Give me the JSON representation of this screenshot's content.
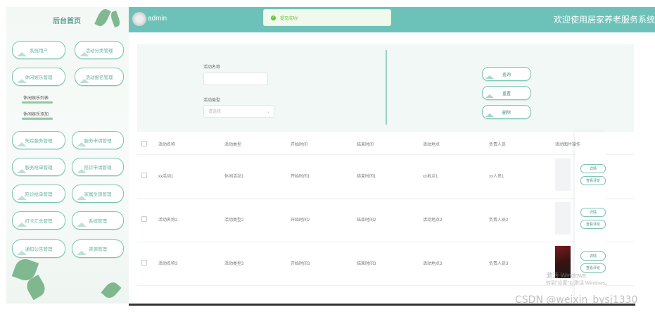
{
  "sidebar": {
    "title": "后台首页",
    "buttons": [
      {
        "label": "系统用户"
      },
      {
        "label": "活动分类管理"
      },
      {
        "label": "休闲娱乐管理"
      },
      {
        "label": "活动报名管理"
      },
      {
        "label": "失踪服务管理"
      },
      {
        "label": "服务申请管理"
      },
      {
        "label": "服务抢单管理"
      },
      {
        "label": "陪诊申请管理"
      },
      {
        "label": "陪诊抢单管理"
      },
      {
        "label": "家属反馈管理"
      },
      {
        "label": "打卡汇总管理"
      },
      {
        "label": "系统管理"
      },
      {
        "label": "通知公告管理"
      },
      {
        "label": "资源管理"
      }
    ],
    "sub_items": [
      "休闲娱乐列表",
      "休闲娱乐添加"
    ]
  },
  "header": {
    "user": "admin",
    "welcome": "欢迎使用居家养老服务系统"
  },
  "toast": {
    "text": "提交成功!"
  },
  "search": {
    "name_label": "活动名称",
    "name_value": "",
    "type_label": "活动类型",
    "type_placeholder": "请选择",
    "btn_query": "查询",
    "btn_reset": "重置",
    "btn_delete": "删除"
  },
  "table": {
    "columns": [
      "活动名称",
      "活动类型",
      "开始时间",
      "结束时间",
      "活动地点",
      "负责人员",
      "活动图片",
      "操作"
    ],
    "rows": [
      {
        "name": "xx活动1",
        "type": "休闲活动1",
        "start": "开始时间1",
        "end": "结束时间1",
        "place": "xx地点1",
        "person": "xx人员1"
      },
      {
        "name": "活动名称2",
        "type": "活动类型2",
        "start": "开始时间2",
        "end": "结束时间2",
        "place": "活动地点2",
        "person": "负责人员2"
      },
      {
        "name": "活动名称3",
        "type": "活动类型3",
        "start": "开始时间3",
        "end": "结束时间3",
        "place": "活动地点3",
        "person": "负责人员3"
      }
    ],
    "op_detail": "详情",
    "op_review": "查看评论"
  },
  "overlay": {
    "activate_windows": "激活 Windows",
    "activate_hint": "转到\"设置\"以激活 Windows。",
    "csdn": "CSDN @weixin_bysj1330"
  }
}
